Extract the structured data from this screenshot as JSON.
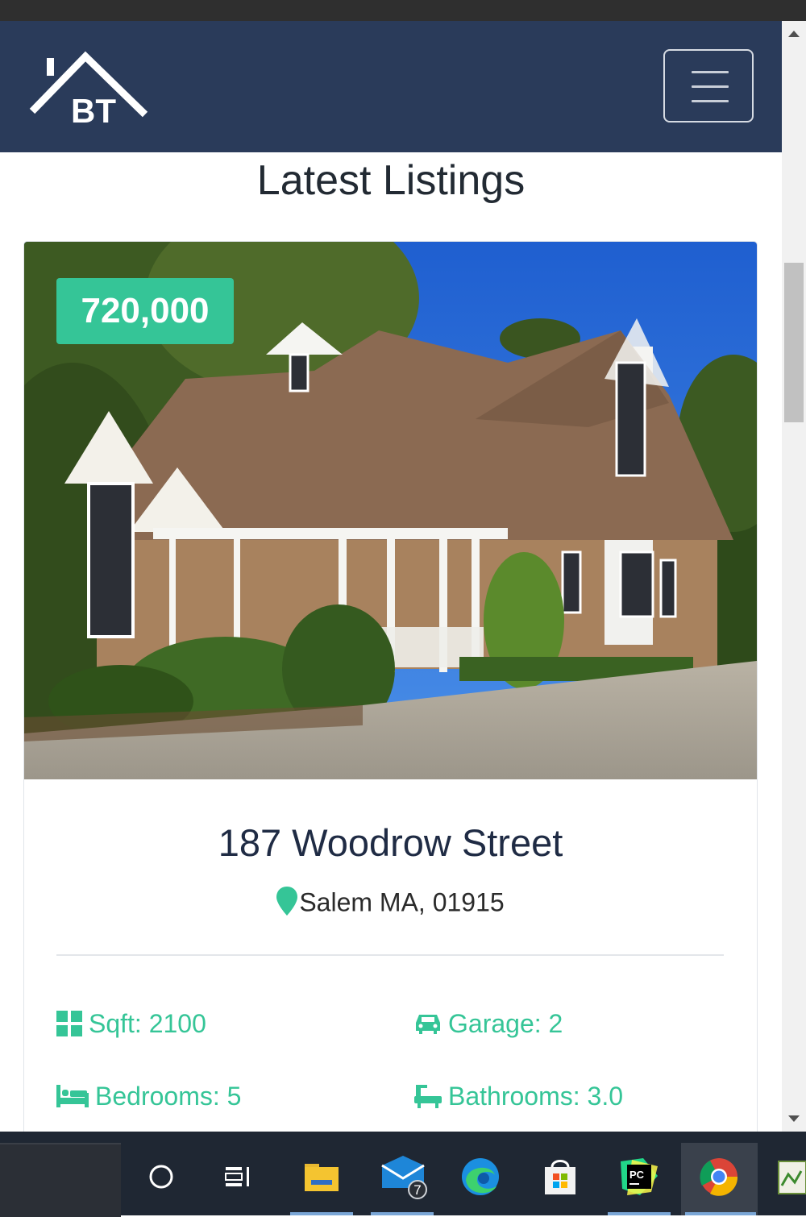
{
  "navbar": {
    "logo_text": "BT",
    "menu_button": "menu"
  },
  "section": {
    "title": "Latest Listings"
  },
  "listing": {
    "price": "720,000",
    "title": "187 Woodrow Street",
    "location": "Salem MA, 01915",
    "features": {
      "sqft": "Sqft: 2100",
      "garage": "Garage: 2",
      "bedrooms": "Bedrooms: 5",
      "bathrooms": "Bathrooms: 3.0"
    }
  },
  "taskbar": {
    "mail_badge": "7",
    "items": [
      "cortana-icon",
      "task-view-icon",
      "file-explorer-icon",
      "mail-icon",
      "edge-icon",
      "store-icon",
      "pycharm-icon",
      "chrome-icon",
      "photos-icon"
    ]
  },
  "colors": {
    "navbar_bg": "#2a3b5a",
    "accent": "#35c597",
    "title_text": "#1f2b44"
  }
}
